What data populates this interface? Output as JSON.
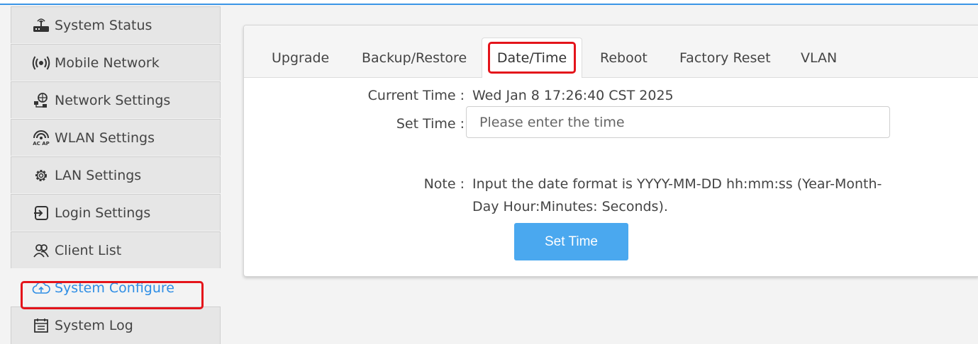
{
  "sidebar": {
    "items": [
      {
        "label": "System Status",
        "icon": "router-icon"
      },
      {
        "label": "Mobile Network",
        "icon": "signal-icon"
      },
      {
        "label": "Network Settings",
        "icon": "network-icon"
      },
      {
        "label": "WLAN Settings",
        "icon": "wifi-ap-icon"
      },
      {
        "label": "LAN Settings",
        "icon": "gear-icon"
      },
      {
        "label": "Login Settings",
        "icon": "login-icon"
      },
      {
        "label": "Client List",
        "icon": "users-icon"
      },
      {
        "label": "System Configure",
        "icon": "cloud-upload-icon",
        "active": true
      },
      {
        "label": "System Log",
        "icon": "log-icon"
      }
    ]
  },
  "tabs": [
    "Upgrade",
    "Backup/Restore",
    "Date/Time",
    "Reboot",
    "Factory Reset",
    "VLAN"
  ],
  "active_tab": "Date/Time",
  "form": {
    "current_time_label": "Current Time :",
    "current_time_value": "Wed Jan 8 17:26:40 CST 2025",
    "set_time_label": "Set Time :",
    "set_time_placeholder": "Please enter the time",
    "note_label": "Note :",
    "note_text": "Input the date format is YYYY-MM-DD hh:mm:ss (Year-Month-Day Hour:Minutes: Seconds).",
    "button_label": "Set Time"
  },
  "colors": {
    "accent": "#2f8ee5",
    "button": "#4aa8ef",
    "highlight": "#e4141b"
  }
}
